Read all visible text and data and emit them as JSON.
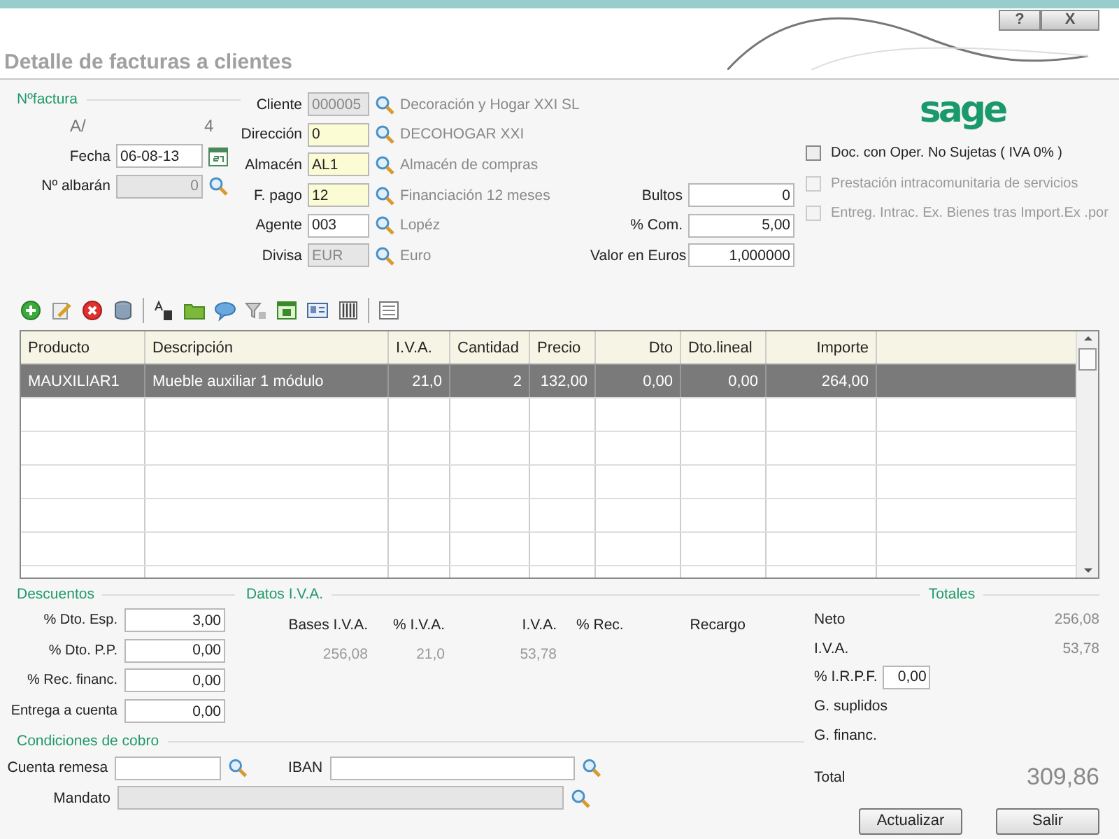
{
  "window": {
    "help_button": "?",
    "close_button": "X"
  },
  "title": "Detalle de facturas a clientes",
  "invoice": {
    "section": "Nºfactura",
    "series": "A/",
    "number": "4",
    "fields": [
      {
        "label": "Fecha",
        "value": "06-08-13",
        "kind": "date",
        "disabled": false
      },
      {
        "label": "Nº albarán",
        "value": "0",
        "kind": "lookup",
        "disabled": true
      }
    ]
  },
  "customer_fields": [
    {
      "label": "Cliente",
      "value": "000005",
      "required": false,
      "disabled": true,
      "description": "Decoración y Hogar XXI SL"
    },
    {
      "label": "Dirección",
      "value": "0",
      "required": true,
      "disabled": false,
      "description": "DECOHOGAR XXI"
    },
    {
      "label": "Almacén",
      "value": "AL1",
      "required": true,
      "disabled": false,
      "description": "Almacén de compras"
    },
    {
      "label": "F. pago",
      "value": "12",
      "required": true,
      "disabled": false,
      "description": "Financiación 12 meses"
    },
    {
      "label": "Agente",
      "value": "003",
      "required": false,
      "disabled": false,
      "description": "Lopéz"
    },
    {
      "label": "Divisa",
      "value": "EUR",
      "required": false,
      "disabled": true,
      "description": "Euro"
    }
  ],
  "amounts": [
    {
      "label": "Bultos",
      "value": "0"
    },
    {
      "label": "% Com.",
      "value": "5,00"
    },
    {
      "label": "Valor en Euros",
      "value": "1,000000"
    }
  ],
  "logo": "sage",
  "options": [
    {
      "label": "Doc. con Oper. No Sujetas ( IVA 0% )",
      "checked": false,
      "disabled": false
    },
    {
      "label": "Prestación  intracomunitaria de servicios",
      "checked": false,
      "disabled": true
    },
    {
      "label": "Entreg. Intrac. Ex. Bienes tras Import.Ex .por",
      "checked": false,
      "disabled": true
    }
  ],
  "table": {
    "columns": [
      {
        "label": "Producto",
        "numeric": false
      },
      {
        "label": "Descripción",
        "numeric": false
      },
      {
        "label": "I.V.A.",
        "numeric": false
      },
      {
        "label": "Cantidad",
        "numeric": false
      },
      {
        "label": "Precio",
        "numeric": false
      },
      {
        "label": "Dto",
        "numeric": true
      },
      {
        "label": "Dto.lineal",
        "numeric": false
      },
      {
        "label": "Importe",
        "numeric": true
      }
    ],
    "rows": [
      {
        "selected": true,
        "cells": [
          "MAUXILIAR1",
          "Mueble auxiliar 1 módulo",
          "21,0",
          "2",
          "132,00",
          "0,00",
          "0,00",
          "264,00"
        ]
      }
    ]
  },
  "discounts": {
    "title": "Descuentos",
    "fields": [
      {
        "label": "% Dto. Esp.",
        "value": "3,00"
      },
      {
        "label": "% Dto. P.P.",
        "value": "0,00"
      },
      {
        "label": "% Rec. financ.",
        "value": "0,00"
      },
      {
        "label": "Entrega a cuenta",
        "value": "0,00"
      }
    ]
  },
  "vat": {
    "title": "Datos I.V.A.",
    "columns": [
      "Bases I.V.A.",
      "% I.V.A.",
      "I.V.A.",
      "% Rec.",
      "Recargo"
    ],
    "rows": [
      [
        "256,08",
        "21,0",
        "53,78"
      ]
    ]
  },
  "payment": {
    "title": "Condiciones de cobro",
    "fields": [
      {
        "label": "Cuenta remesa",
        "disabled": false
      },
      {
        "label": "IBAN",
        "disabled": false
      },
      {
        "label": "Mandato",
        "disabled": true
      }
    ]
  },
  "totals": {
    "title": "Totales",
    "rows": [
      {
        "label": "Neto",
        "value": "256,08",
        "kind": "amount"
      },
      {
        "label": "I.V.A.",
        "value": "53,78",
        "kind": "amount"
      },
      {
        "label": "% I.R.P.F.",
        "value": "0,00",
        "kind": "input"
      },
      {
        "label": "G. suplidos",
        "kind": "amount"
      },
      {
        "label": "G. financ.",
        "kind": "amount"
      },
      {
        "label": "Total",
        "value": "309,86",
        "kind": "total"
      }
    ]
  },
  "buttons": [
    "Actualizar",
    "Salir"
  ]
}
